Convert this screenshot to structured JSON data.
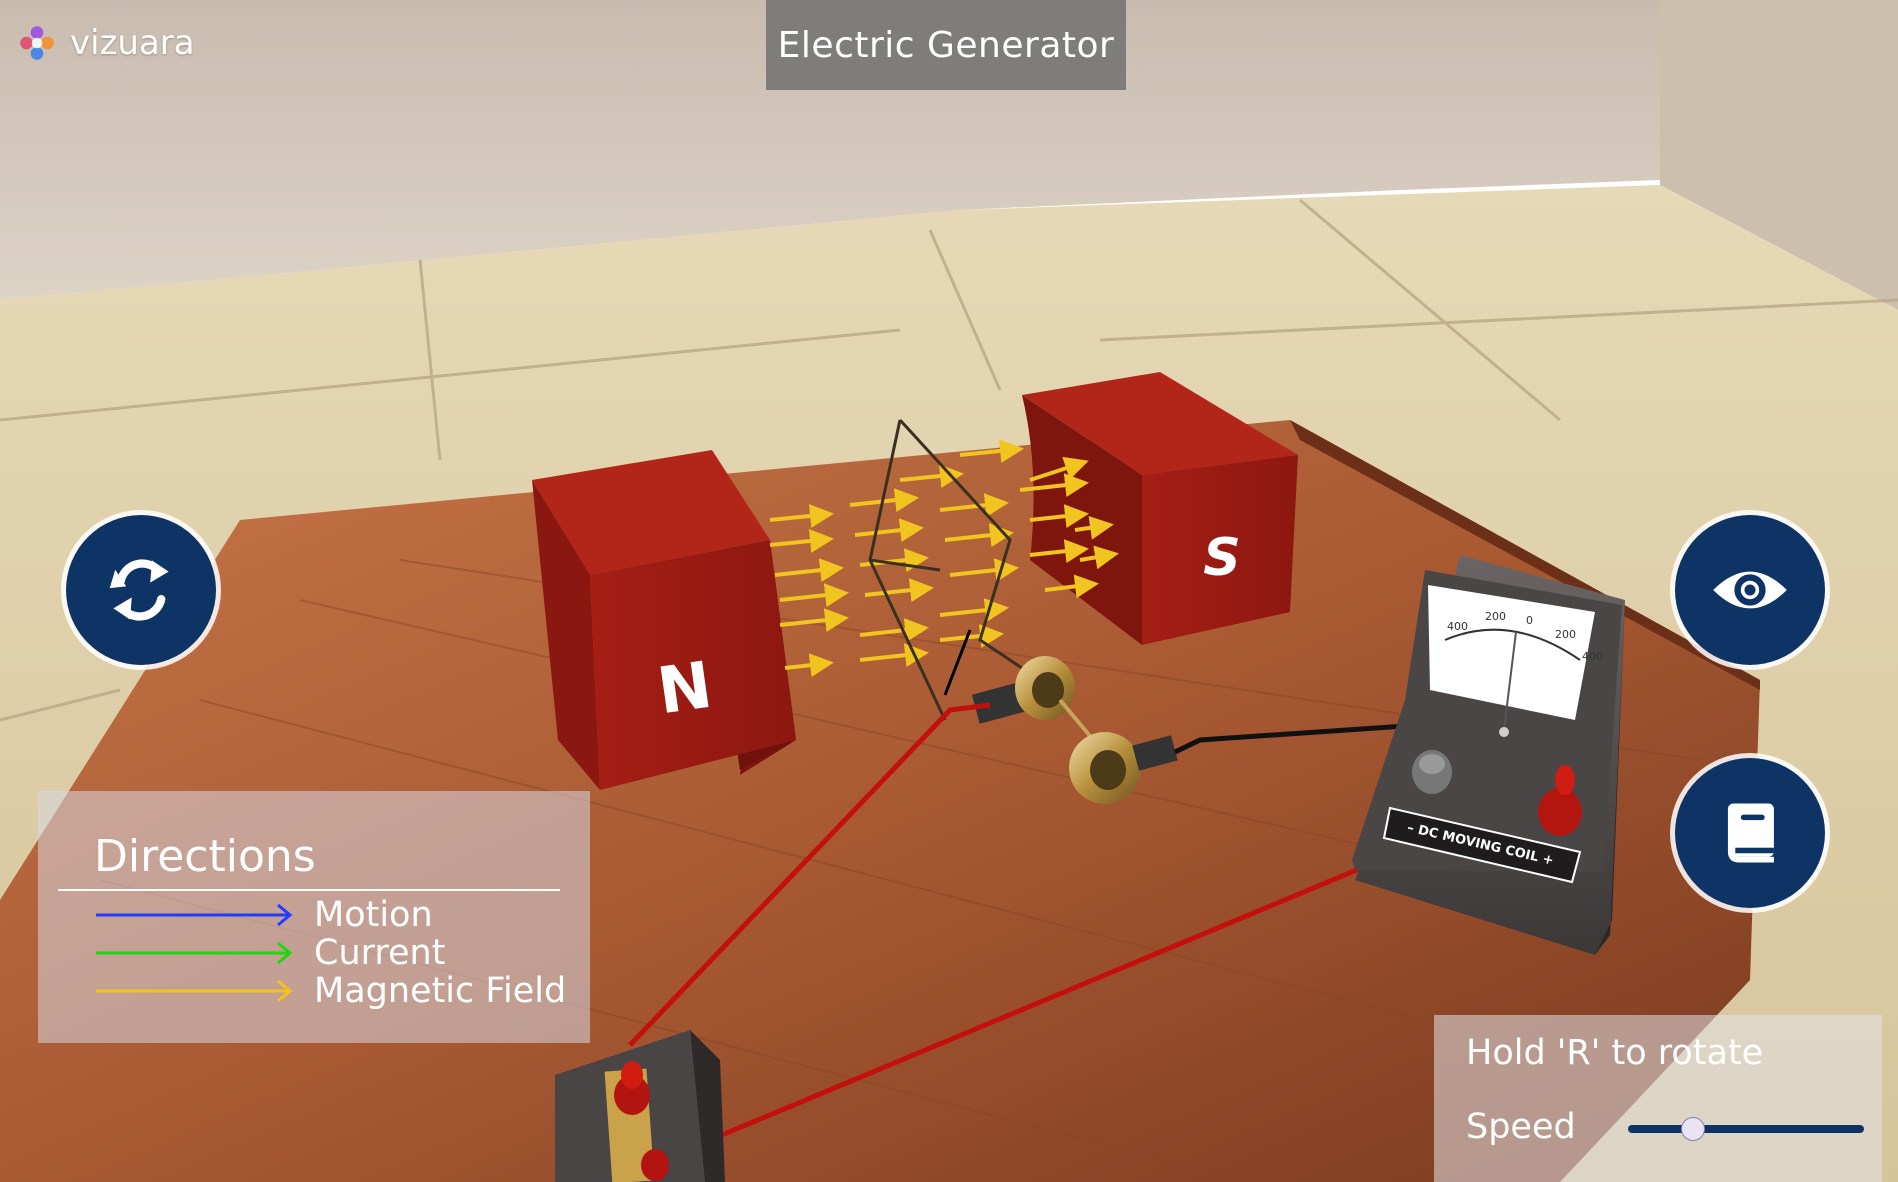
{
  "app": {
    "brand": "vizuara",
    "title": "Electric Generator"
  },
  "scene": {
    "magnet_north_label": "N",
    "magnet_south_label": "S",
    "meter_scale": [
      "400",
      "200",
      "0",
      "200",
      "400"
    ],
    "meter_caption": "– DC MOVING COIL +"
  },
  "left_controls": {
    "rotate_icon": "rotate-refresh-icon"
  },
  "right_controls": {
    "view_icon": "eye-icon",
    "book_icon": "book-icon"
  },
  "directions": {
    "title": "Directions",
    "items": [
      {
        "label": "Motion",
        "color": "#1f3cff"
      },
      {
        "label": "Current",
        "color": "#21d60f"
      },
      {
        "label": "Magnetic Field",
        "color": "#f4c21c"
      }
    ]
  },
  "controls_panel": {
    "hint": "Hold 'R' to rotate",
    "speed_label": "Speed",
    "speed_value": 0.27
  },
  "colors": {
    "accent": "#0e3466",
    "magnet": "#9c1d14",
    "wire": "#c4100d"
  }
}
